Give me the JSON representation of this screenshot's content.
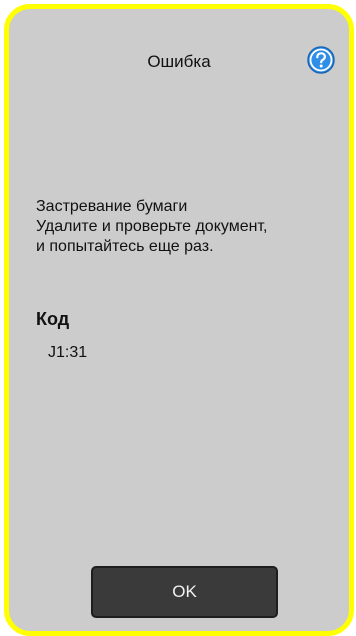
{
  "dialog": {
    "title": "Ошибка",
    "help_icon": "help-question-icon",
    "message_lines": [
      "Застревание бумаги",
      "Удалите и проверьте документ,",
      "и попытайтесь еще раз."
    ],
    "code_label": "Код",
    "code_value": "J1:31",
    "ok_label": "OK"
  },
  "colors": {
    "border": "#ffff00",
    "panel": "#cccccc",
    "button": "#3a3a3a",
    "help_icon": "#2f8ee6"
  }
}
